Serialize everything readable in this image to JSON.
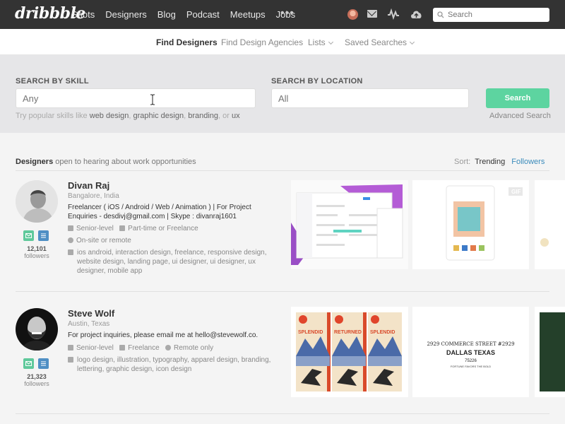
{
  "nav": {
    "logo": "dribbble",
    "links": [
      "Shots",
      "Designers",
      "Blog",
      "Podcast",
      "Meetups",
      "Jobs"
    ],
    "more": "•••",
    "search_placeholder": "Search"
  },
  "subnav": {
    "find_designers": "Find Designers",
    "find_agencies": "Find Design Agencies",
    "lists": "Lists",
    "saved_searches": "Saved Searches"
  },
  "search": {
    "skill_label": "SEARCH BY SKILL",
    "skill_placeholder": "Any",
    "location_label": "SEARCH BY LOCATION",
    "location_placeholder": "All",
    "button": "Search",
    "advanced": "Advanced Search",
    "hint_prefix": "Try popular skills like",
    "hint_skill_1": "web design",
    "hint_skill_2": "graphic design",
    "hint_skill_3": "branding",
    "hint_or": "or",
    "hint_skill_4": "ux"
  },
  "results": {
    "heading_bold": "Designers",
    "heading_rest": "open to hearing about work opportunities",
    "sort_label": "Sort:",
    "sort_trending": "Trending",
    "sort_followers": "Followers"
  },
  "designers": [
    {
      "name": "Divan Raj",
      "location": "Bangalore, India",
      "bio": "Freelancer ( iOS / Android / Web / Animation ) | For Project Enquiries - desdivj@gmail.com | Skype : divanraj1601",
      "level": "Senior-level",
      "availability": "Part-time or Freelance",
      "work_mode": "On-site or remote",
      "skills": "ios android, interaction design, freelance, responsive design, website design, landing page, ui designer, ui designer, ux designer, mobile app",
      "followers_count": "12,101",
      "followers_label": "followers"
    },
    {
      "name": "Steve Wolf",
      "location": "Austin, Texas",
      "bio": "For project inquiries, please email me at hello@stevewolf.co.",
      "level": "Senior-level",
      "availability": "Freelance",
      "work_mode": "Remote only",
      "skills": "logo design, illustration, typography, apparel design, branding, lettering, graphic design, icon design",
      "followers_count": "21,323",
      "followers_label": "followers"
    }
  ],
  "shots": {
    "gif_badge": "GIF",
    "poster_1": "SPLENDID",
    "poster_2": "RETURNED",
    "poster_3": "SPLENDID",
    "badge_line_1": "2929 COMMERCE STREET #2929",
    "badge_line_2": "DALLAS TEXAS",
    "badge_line_3": "75226",
    "badge_line_4": "FORTUNE FAVORS THE BOLD"
  },
  "colors": {
    "nav_bg": "#333333",
    "accent_green": "#5dd4a0",
    "link_blue": "#3a8bbb",
    "mini_green": "#5fc99b",
    "mini_blue": "#4f8fc4"
  }
}
